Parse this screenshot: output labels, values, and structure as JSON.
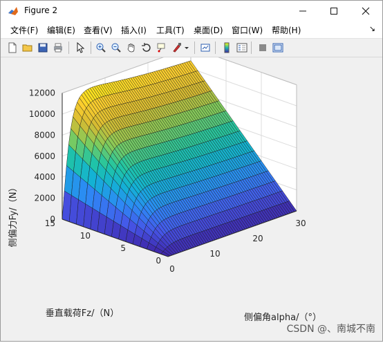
{
  "window": {
    "title": "Figure 2"
  },
  "menu": [
    "文件(F)",
    "编辑(E)",
    "查看(V)",
    "插入(I)",
    "工具(T)",
    "桌面(D)",
    "窗口(W)",
    "帮助(H)"
  ],
  "toolbar_icons": [
    "new-figure-icon",
    "open-icon",
    "save-icon",
    "print-icon",
    "pointer-icon",
    "zoom-in-icon",
    "zoom-out-icon",
    "pan-icon",
    "rotate-3d-icon",
    "data-cursor-icon",
    "brush-icon",
    "dropdown-arrow-icon",
    "link-plot-icon",
    "insert-colorbar-icon",
    "insert-legend-icon",
    "hide-plot-tools-icon",
    "show-plot-tools-icon"
  ],
  "chart_data": {
    "type": "surface",
    "zlabel": "侧偏力Fy/（N）",
    "xlabel": "侧偏角alpha/（°）",
    "ylabel": "垂直载荷Fz/（N）",
    "xlim": [
      0,
      30
    ],
    "ylim": [
      0,
      15
    ],
    "zlim": [
      0,
      12000
    ],
    "x_ticks": [
      "0",
      "10",
      "20",
      "30"
    ],
    "y_ticks": [
      "0",
      "5",
      "10",
      "15"
    ],
    "z_ticks": [
      "0",
      "2000",
      "4000",
      "6000",
      "8000",
      "10000",
      "12000"
    ],
    "grid": true,
    "colormap": "parula",
    "description_hidden": true
  },
  "watermark": "CSDN @、南城不南"
}
